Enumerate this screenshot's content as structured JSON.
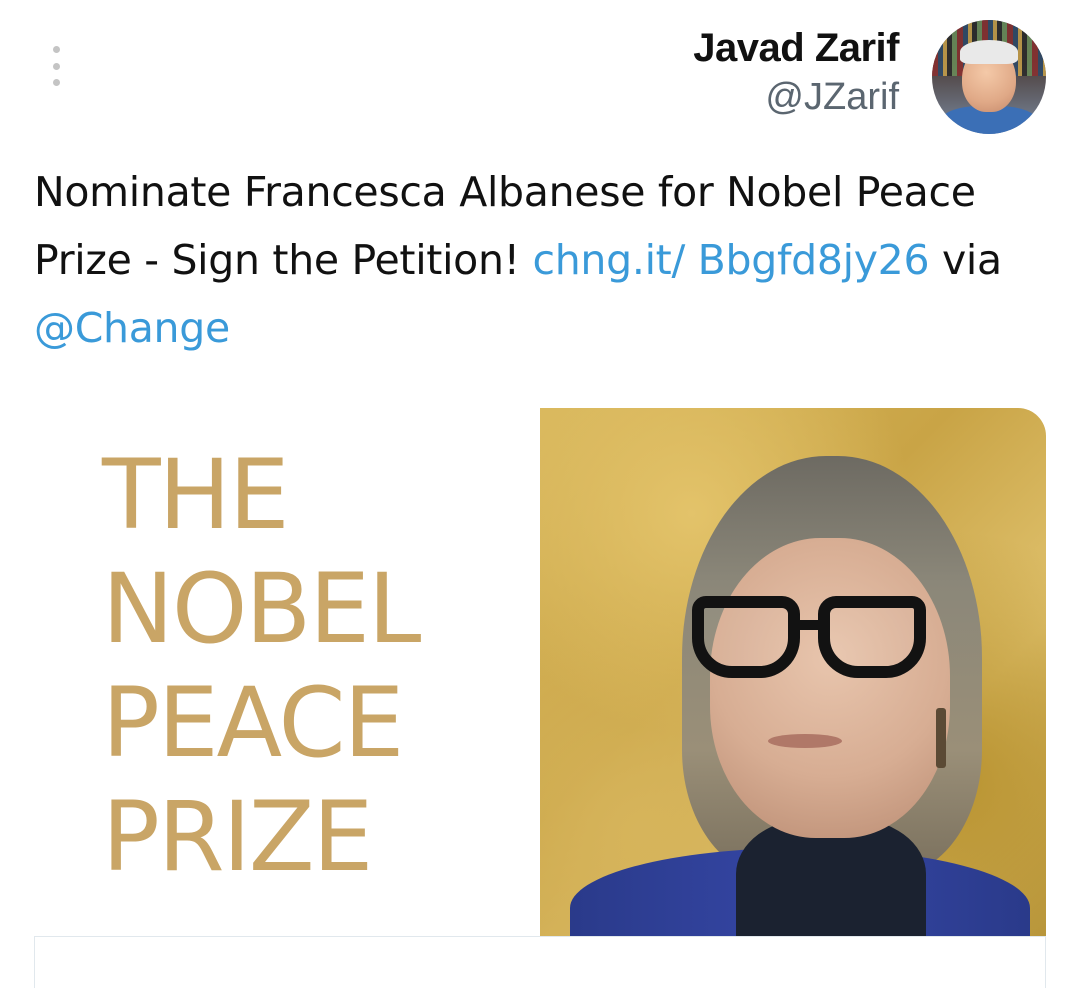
{
  "header": {
    "more_icon": "vertical-ellipsis-icon",
    "author_name": "Javad Zarif",
    "author_handle": "@JZarif"
  },
  "tweet": {
    "text_prefix": "Nominate Francesca Albanese for Nobel Peace Prize - Sign the Petition! ",
    "link_text": "chng.it/ Bbgfd8jy26",
    "middle_text": " via ",
    "mention_text": "@Change"
  },
  "card": {
    "image_text_lines": [
      "THE",
      "NOBEL",
      "PEACE",
      "PRIZE"
    ]
  },
  "colors": {
    "link": "#3a9ad9",
    "gold": "#c9a566",
    "handle_gray": "#5b6670"
  }
}
